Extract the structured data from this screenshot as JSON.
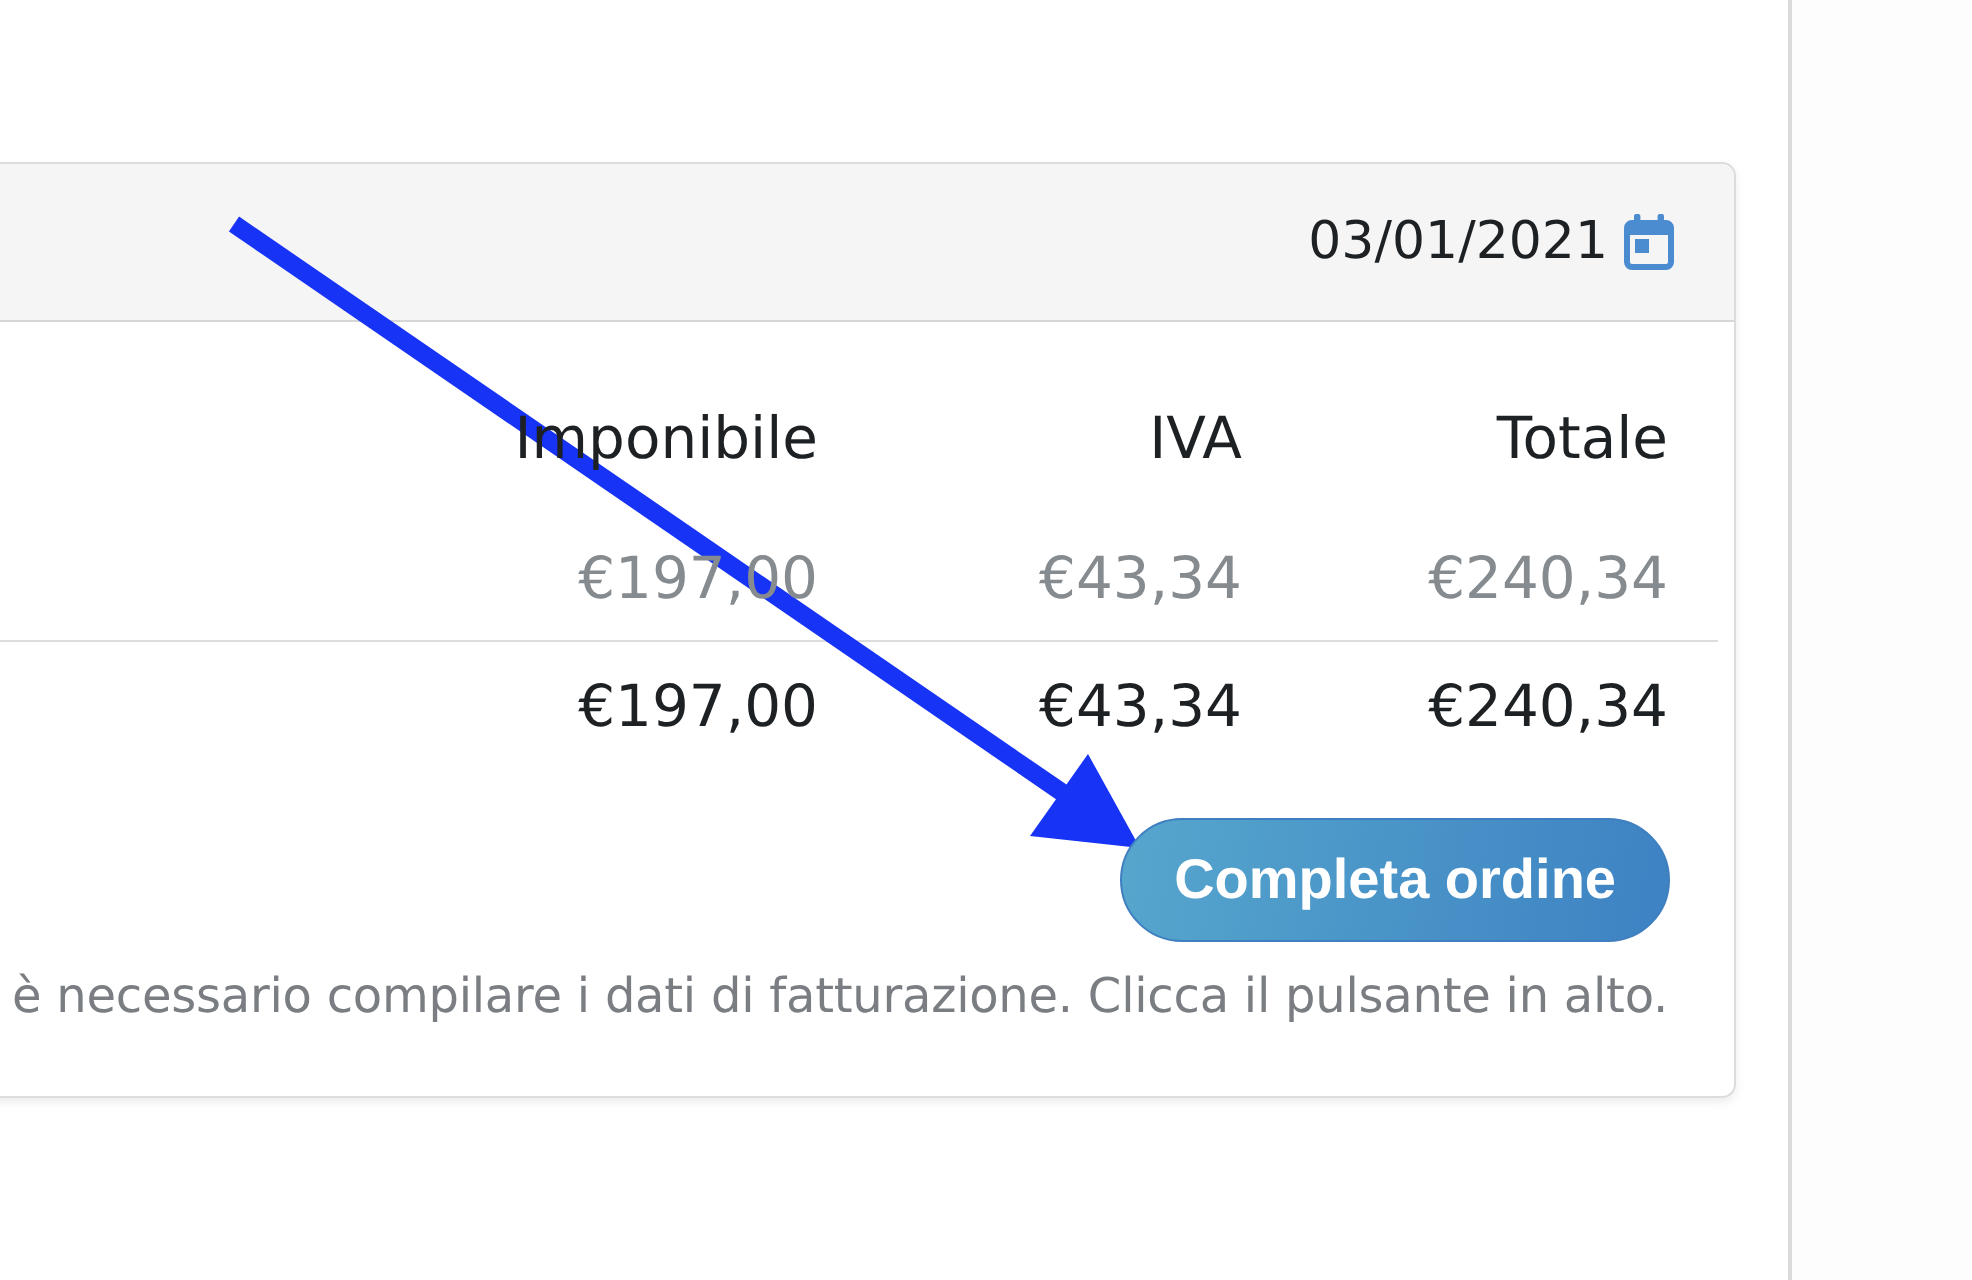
{
  "order_card": {
    "date": "03/01/2021",
    "table": {
      "columns": [
        "Imponibile",
        "IVA",
        "Totale"
      ],
      "rows": [
        {
          "cells": [
            "€197,00",
            "€43,34",
            "€240,34"
          ],
          "muted": true
        },
        {
          "cells": [
            "€197,00",
            "€43,34",
            "€240,34"
          ],
          "muted": false
        }
      ]
    },
    "button": {
      "label": "Completa ordine"
    },
    "note": "è necessario compilare i dati di fatturazione. Clicca il pulsante in alto."
  },
  "annotation": {
    "kind": "arrow"
  }
}
